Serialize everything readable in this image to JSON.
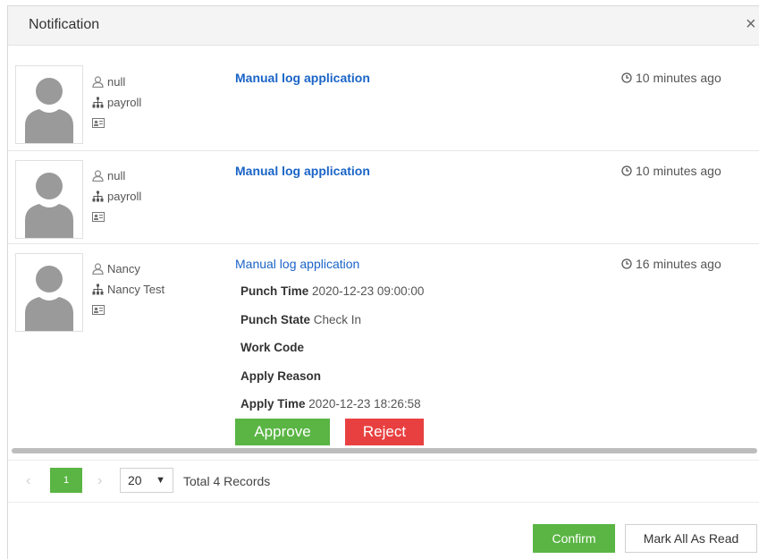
{
  "dialog": {
    "title": "Notification",
    "close_glyph": "×"
  },
  "notifications": [
    {
      "user": "null",
      "department": "payroll",
      "title": "Manual log application",
      "time": "10 minutes ago"
    },
    {
      "user": "null",
      "department": "payroll",
      "title": "Manual log application",
      "time": "10 minutes ago"
    },
    {
      "user": "Nancy",
      "department": "Nancy Test",
      "title": "Manual log application",
      "time": "16 minutes ago",
      "details": [
        {
          "label": "Punch Time",
          "value": "2020-12-23 09:00:00"
        },
        {
          "label": "Punch State",
          "value": "Check In"
        },
        {
          "label": "Work Code",
          "value": ""
        },
        {
          "label": "Apply Reason",
          "value": ""
        },
        {
          "label": "Apply Time",
          "value": "2020-12-23 18:26:58"
        }
      ],
      "approve_label": "Approve",
      "reject_label": "Reject"
    }
  ],
  "pagination": {
    "prev_glyph": "‹",
    "current_page": "1",
    "next_glyph": "›",
    "page_size": "20",
    "total_text": "Total 4 Records"
  },
  "footer": {
    "confirm_label": "Confirm",
    "mark_all_read_label": "Mark All As Read"
  },
  "colors": {
    "accent_green": "#5ab544",
    "reject_red": "#e84040",
    "link_blue": "#1a64c7"
  },
  "icons": [
    "user-icon",
    "org-icon",
    "id-card-icon",
    "clock-icon",
    "avatar-silhouette",
    "close-icon"
  ]
}
